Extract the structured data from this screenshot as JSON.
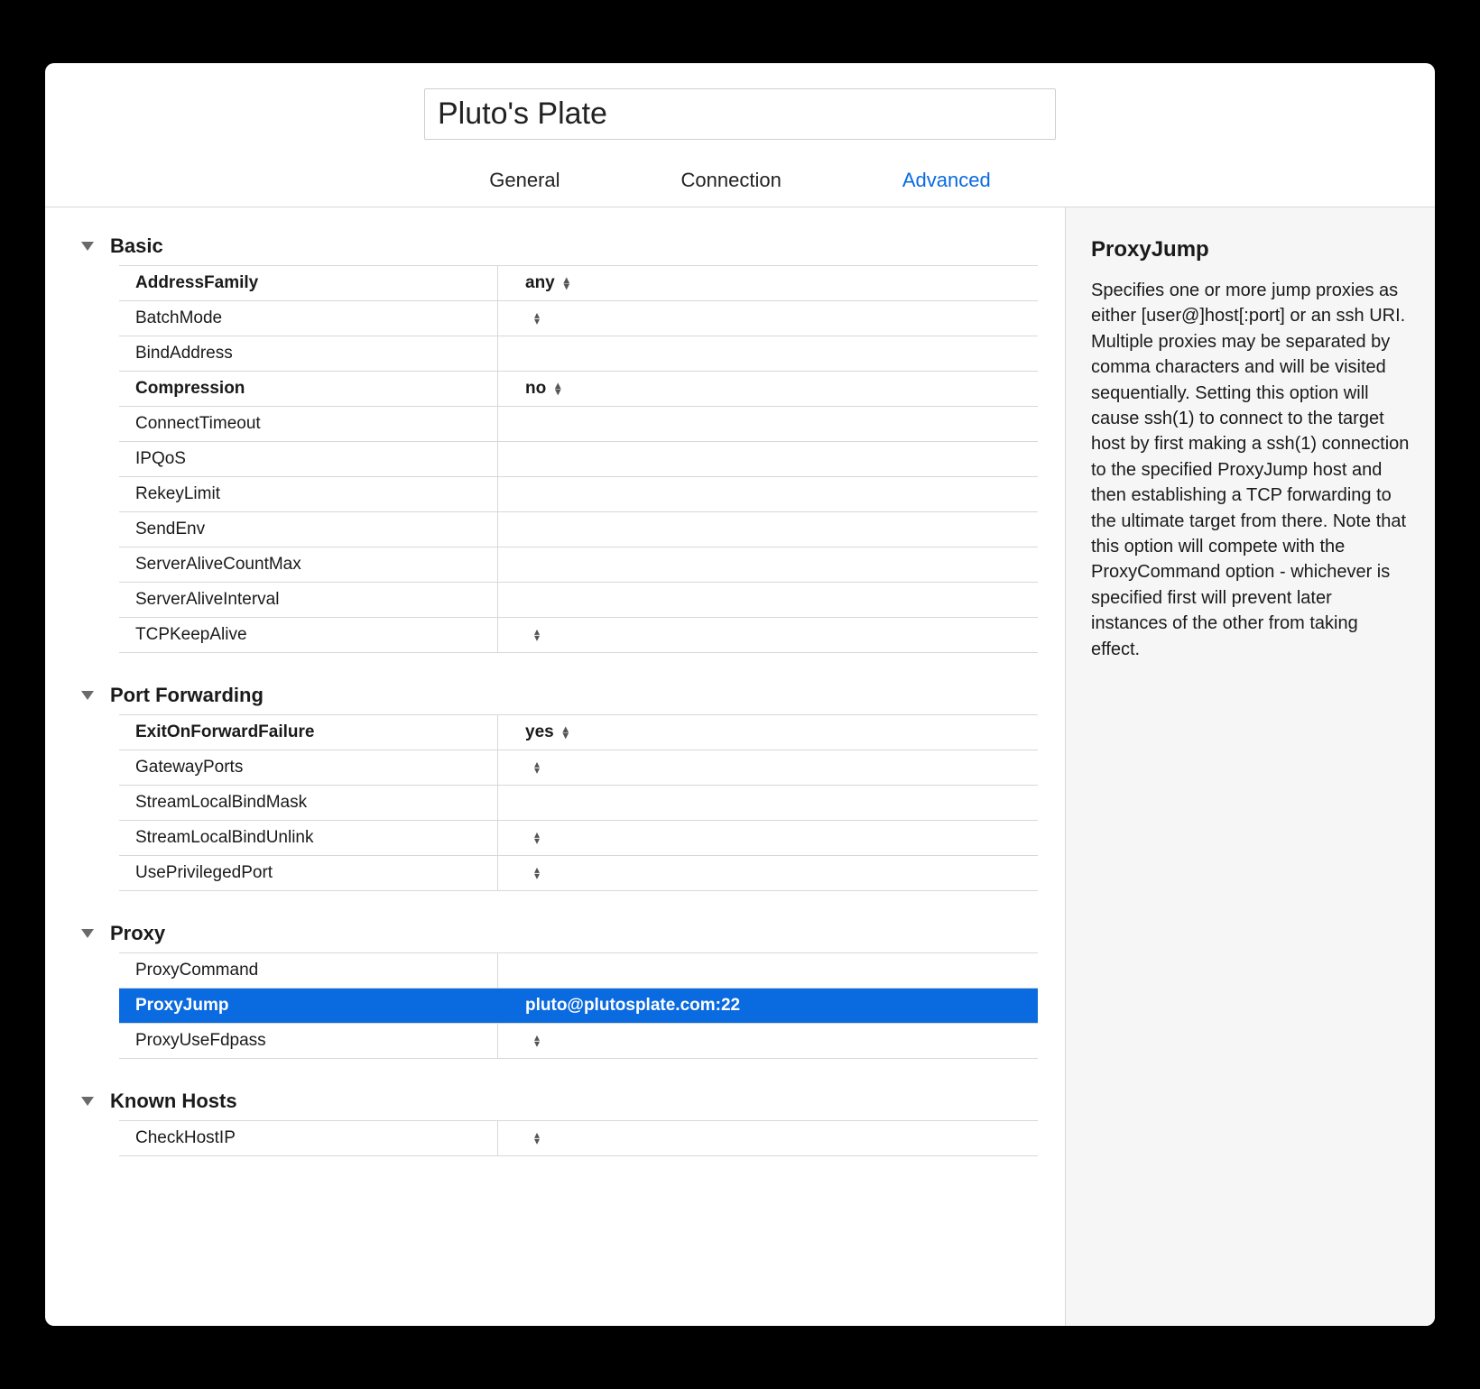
{
  "title_value": "Pluto's Plate",
  "tabs": {
    "general": "General",
    "connection": "Connection",
    "advanced": "Advanced"
  },
  "sections": [
    {
      "title": "Basic",
      "rows": [
        {
          "key": "AddressFamily",
          "value": "any",
          "bold": true,
          "stepper": true
        },
        {
          "key": "BatchMode",
          "value": "",
          "bold": false,
          "stepper": true
        },
        {
          "key": "BindAddress",
          "value": "",
          "bold": false,
          "stepper": false
        },
        {
          "key": "Compression",
          "value": "no",
          "bold": true,
          "stepper": true
        },
        {
          "key": "ConnectTimeout",
          "value": "",
          "bold": false,
          "stepper": false
        },
        {
          "key": "IPQoS",
          "value": "",
          "bold": false,
          "stepper": false
        },
        {
          "key": "RekeyLimit",
          "value": "",
          "bold": false,
          "stepper": false
        },
        {
          "key": "SendEnv",
          "value": "",
          "bold": false,
          "stepper": false
        },
        {
          "key": "ServerAliveCountMax",
          "value": "",
          "bold": false,
          "stepper": false
        },
        {
          "key": "ServerAliveInterval",
          "value": "",
          "bold": false,
          "stepper": false
        },
        {
          "key": "TCPKeepAlive",
          "value": "",
          "bold": false,
          "stepper": true
        }
      ]
    },
    {
      "title": "Port Forwarding",
      "rows": [
        {
          "key": "ExitOnForwardFailure",
          "value": "yes",
          "bold": true,
          "stepper": true
        },
        {
          "key": "GatewayPorts",
          "value": "",
          "bold": false,
          "stepper": true
        },
        {
          "key": "StreamLocalBindMask",
          "value": "",
          "bold": false,
          "stepper": false
        },
        {
          "key": "StreamLocalBindUnlink",
          "value": "",
          "bold": false,
          "stepper": true
        },
        {
          "key": "UsePrivilegedPort",
          "value": "",
          "bold": false,
          "stepper": true
        }
      ]
    },
    {
      "title": "Proxy",
      "rows": [
        {
          "key": "ProxyCommand",
          "value": "",
          "bold": false,
          "stepper": false
        },
        {
          "key": "ProxyJump",
          "value": "pluto@plutosplate.com:22",
          "bold": true,
          "stepper": false,
          "selected": true
        },
        {
          "key": "ProxyUseFdpass",
          "value": "",
          "bold": false,
          "stepper": true
        }
      ]
    },
    {
      "title": "Known Hosts",
      "rows": [
        {
          "key": "CheckHostIP",
          "value": "",
          "bold": false,
          "stepper": true
        }
      ]
    }
  ],
  "help": {
    "title": "ProxyJump",
    "body": "Specifies one or more jump proxies as either [user@]host[:port] or an ssh URI. Multiple proxies may be separated by comma characters and will be visited sequentially. Setting this option will cause ssh(1) to connect to the target host by first making a ssh(1) connection to the specified ProxyJump host and then establishing a TCP forwarding to the ultimate target from there. Note that this option will compete with the ProxyCommand option - whichever is specified first will prevent later instances of the other from taking effect."
  }
}
